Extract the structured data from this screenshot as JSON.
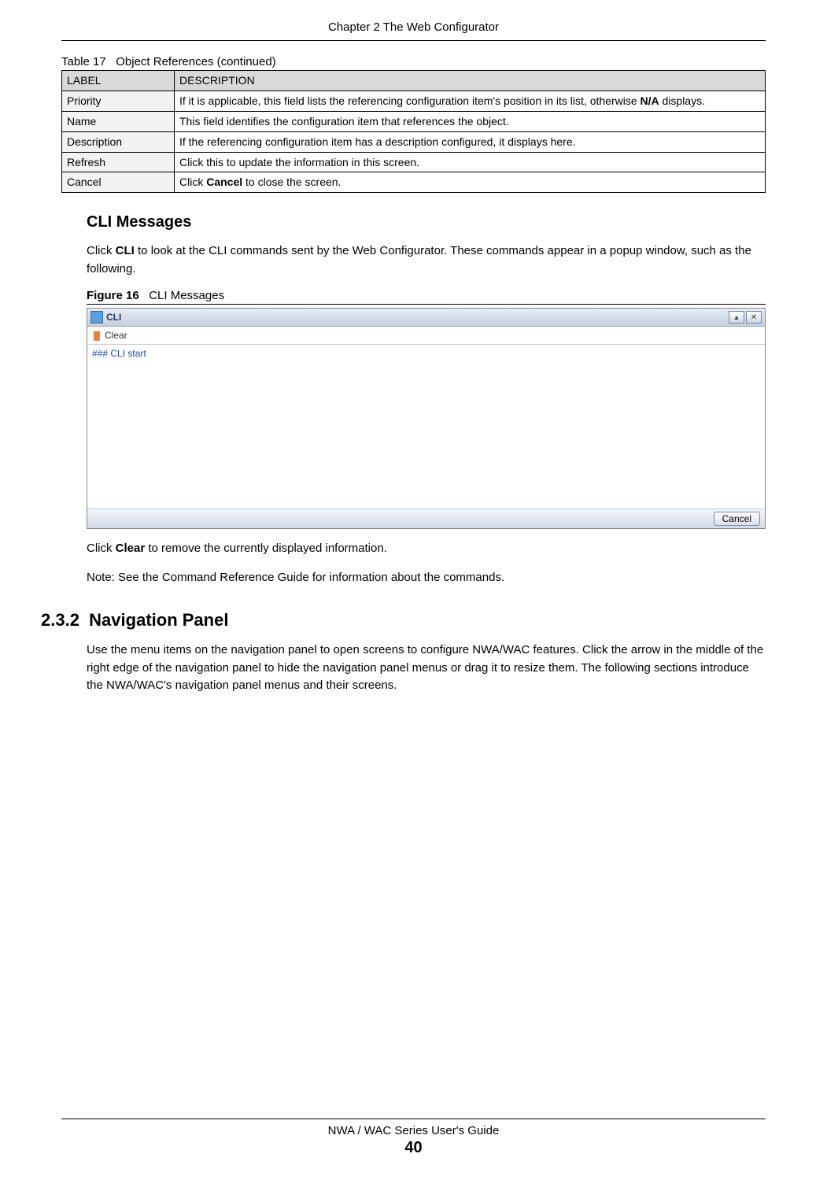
{
  "header": {
    "chapter": "Chapter 2 The Web Configurator"
  },
  "table": {
    "caption_prefix": "Table 17",
    "caption_text": "Object References (continued)",
    "head": {
      "c1": "LABEL",
      "c2": "DESCRIPTION"
    },
    "rows": [
      {
        "label": "Priority",
        "desc_pre": "If it is applicable, this field lists the referencing configuration item's position in its list, otherwise ",
        "bold": "N/A",
        "desc_post": " displays."
      },
      {
        "label": "Name",
        "desc_pre": "This field identifies the configuration item that references the object.",
        "bold": "",
        "desc_post": ""
      },
      {
        "label": "Description",
        "desc_pre": "If the referencing configuration item has a description configured, it displays here.",
        "bold": "",
        "desc_post": ""
      },
      {
        "label": "Refresh",
        "desc_pre": "Click this to update the information in this screen.",
        "bold": "",
        "desc_post": ""
      },
      {
        "label": "Cancel",
        "desc_pre": "Click ",
        "bold": "Cancel",
        "desc_post": " to close the screen."
      }
    ]
  },
  "cli_section": {
    "heading": "CLI Messages",
    "para_pre": "Click ",
    "para_bold": "CLI",
    "para_post": " to look at the CLI commands sent by the Web Configurator. These commands appear in a popup window, such as the following.",
    "fig_prefix": "Figure 16",
    "fig_text": "CLI Messages",
    "window": {
      "title": "CLI",
      "clear": "Clear",
      "body_line": "### CLI start",
      "cancel": "Cancel"
    },
    "after1_pre": "Click ",
    "after1_bold": "Clear",
    "after1_post": " to remove the currently displayed information.",
    "note": "Note: See the Command Reference Guide for information about the commands."
  },
  "nav_section": {
    "number": "2.3.2",
    "title": "Navigation Panel",
    "para": "Use the menu items on the navigation panel to open screens to configure NWA/WAC features. Click the arrow in the middle of the right edge of the navigation panel to hide the navigation panel menus or drag it to resize them. The following sections introduce the NWA/WAC's navigation panel menus and their screens."
  },
  "footer": {
    "title": "NWA / WAC Series User's Guide",
    "page": "40"
  }
}
